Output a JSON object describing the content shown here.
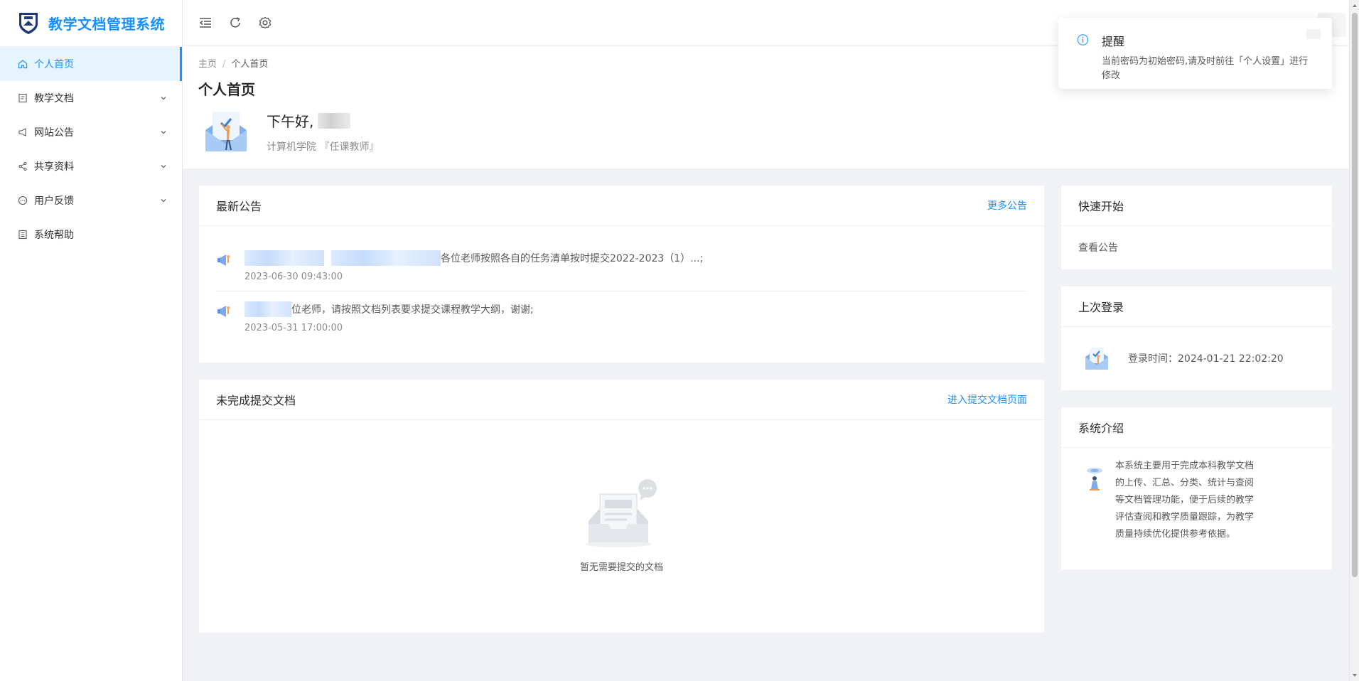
{
  "app": {
    "title": "教学文档管理系统",
    "accent": "#1890ff"
  },
  "sidebar": {
    "items": [
      {
        "label": "个人首页",
        "icon": "home-icon",
        "active": true
      },
      {
        "label": "教学文档",
        "icon": "document-icon",
        "has_children": true
      },
      {
        "label": "网站公告",
        "icon": "megaphone-icon",
        "has_children": true
      },
      {
        "label": "共享资料",
        "icon": "share-icon",
        "has_children": true
      },
      {
        "label": "用户反馈",
        "icon": "chat-icon",
        "has_children": true
      },
      {
        "label": "系统帮助",
        "icon": "help-book-icon"
      }
    ]
  },
  "header": {
    "icons": [
      "collapse-menu-icon",
      "refresh-icon",
      "settings-icon"
    ]
  },
  "page": {
    "breadcrumb": {
      "home": "主页",
      "separator": "/",
      "current": "个人首页"
    },
    "title": "个人首页",
    "greeting": "下午好,",
    "dept": "计算机学院 『任课教师』"
  },
  "notices": {
    "title": "最新公告",
    "more": "更多公告",
    "items": [
      {
        "text": "各位老师按照各自的任务清单按时提交2022-2023（1）...;",
        "time": "2023-06-30 09:43:00"
      },
      {
        "text": "位老师，请按照文档列表要求提交课程教学大纲，谢谢;",
        "time": "2023-05-31 17:00:00"
      }
    ]
  },
  "pending_docs": {
    "title": "未完成提交文档",
    "link": "进入提交文档页面",
    "empty_text": "暂无需要提交的文档"
  },
  "quick_start": {
    "title": "快速开始",
    "items": [
      "查看公告"
    ]
  },
  "last_login": {
    "title": "上次登录",
    "text": "登录时间：2024-01-21 22:02:20"
  },
  "system_intro": {
    "title": "系统介绍",
    "text": "本系统主要用于完成本科教学文档的上传、汇总、分类、统计与查阅等文档管理功能，便于后续的教学评估查阅和教学质量跟踪，为教学质量持续优化提供参考依据。"
  },
  "notification": {
    "title": "提醒",
    "message": "当前密码为初始密码,请及时前往「个人设置」进行修改"
  }
}
